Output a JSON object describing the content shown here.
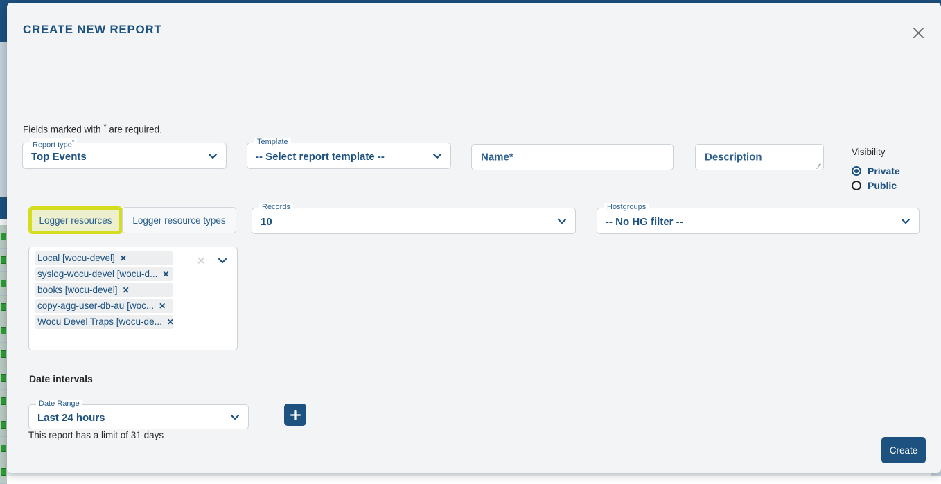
{
  "background": {
    "description": "Application page behind the modal overlay",
    "accent_blue": "#1d5180",
    "accent_yellow": "#cdd844",
    "badge_green": "#2e9e35"
  },
  "modal": {
    "title": "CREATE NEW REPORT",
    "close_icon": "close-icon",
    "required_note_prefix": "Fields marked with",
    "required_note_marker": "*",
    "required_note_suffix": "are required.",
    "fields": {
      "report_type": {
        "label": "Report type",
        "required_marker": "*",
        "value": "Top Events",
        "chevron": "chevron-down-icon"
      },
      "template": {
        "label": "Template",
        "value": "-- Select report template --",
        "chevron": "chevron-down-icon"
      },
      "name": {
        "placeholder": "Name*"
      },
      "description": {
        "placeholder": "Description"
      },
      "records": {
        "label": "Records",
        "value": "10",
        "chevron": "chevron-down-icon"
      },
      "hostgroups": {
        "label": "Hostgroups",
        "value": "-- No HG filter --",
        "chevron": "chevron-down-icon"
      },
      "date_range": {
        "label": "Date Range",
        "value": "Last 24 hours",
        "chevron": "chevron-down-icon"
      }
    },
    "visibility": {
      "title": "Visibility",
      "options": [
        {
          "label": "Private",
          "selected": true
        },
        {
          "label": "Public",
          "selected": false
        }
      ]
    },
    "resource_toggle": {
      "buttons": [
        {
          "label": "Logger resources",
          "highlighted": true
        },
        {
          "label": "Logger resource types",
          "highlighted": false
        }
      ],
      "highlight_color": "#d4de1e",
      "highlight_fill": "#edf0cf"
    },
    "resource_multiselect": {
      "clear_icon": "clear-x-icon",
      "chevron": "chevron-down-icon",
      "chip_remove_label": "✕",
      "chips": [
        {
          "label": "Local [wocu-devel]"
        },
        {
          "label": "syslog-wocu-devel [wocu-d..."
        },
        {
          "label": "books [wocu-devel]"
        },
        {
          "label": "copy-agg-user-db-au [woc..."
        },
        {
          "label": "Wocu Devel Traps [wocu-de..."
        }
      ]
    },
    "date_intervals": {
      "title": "Date intervals",
      "add_button_icon": "plus-icon",
      "limit_note": "This report has a limit of 31 days"
    },
    "footer": {
      "create_label": "Create"
    }
  }
}
